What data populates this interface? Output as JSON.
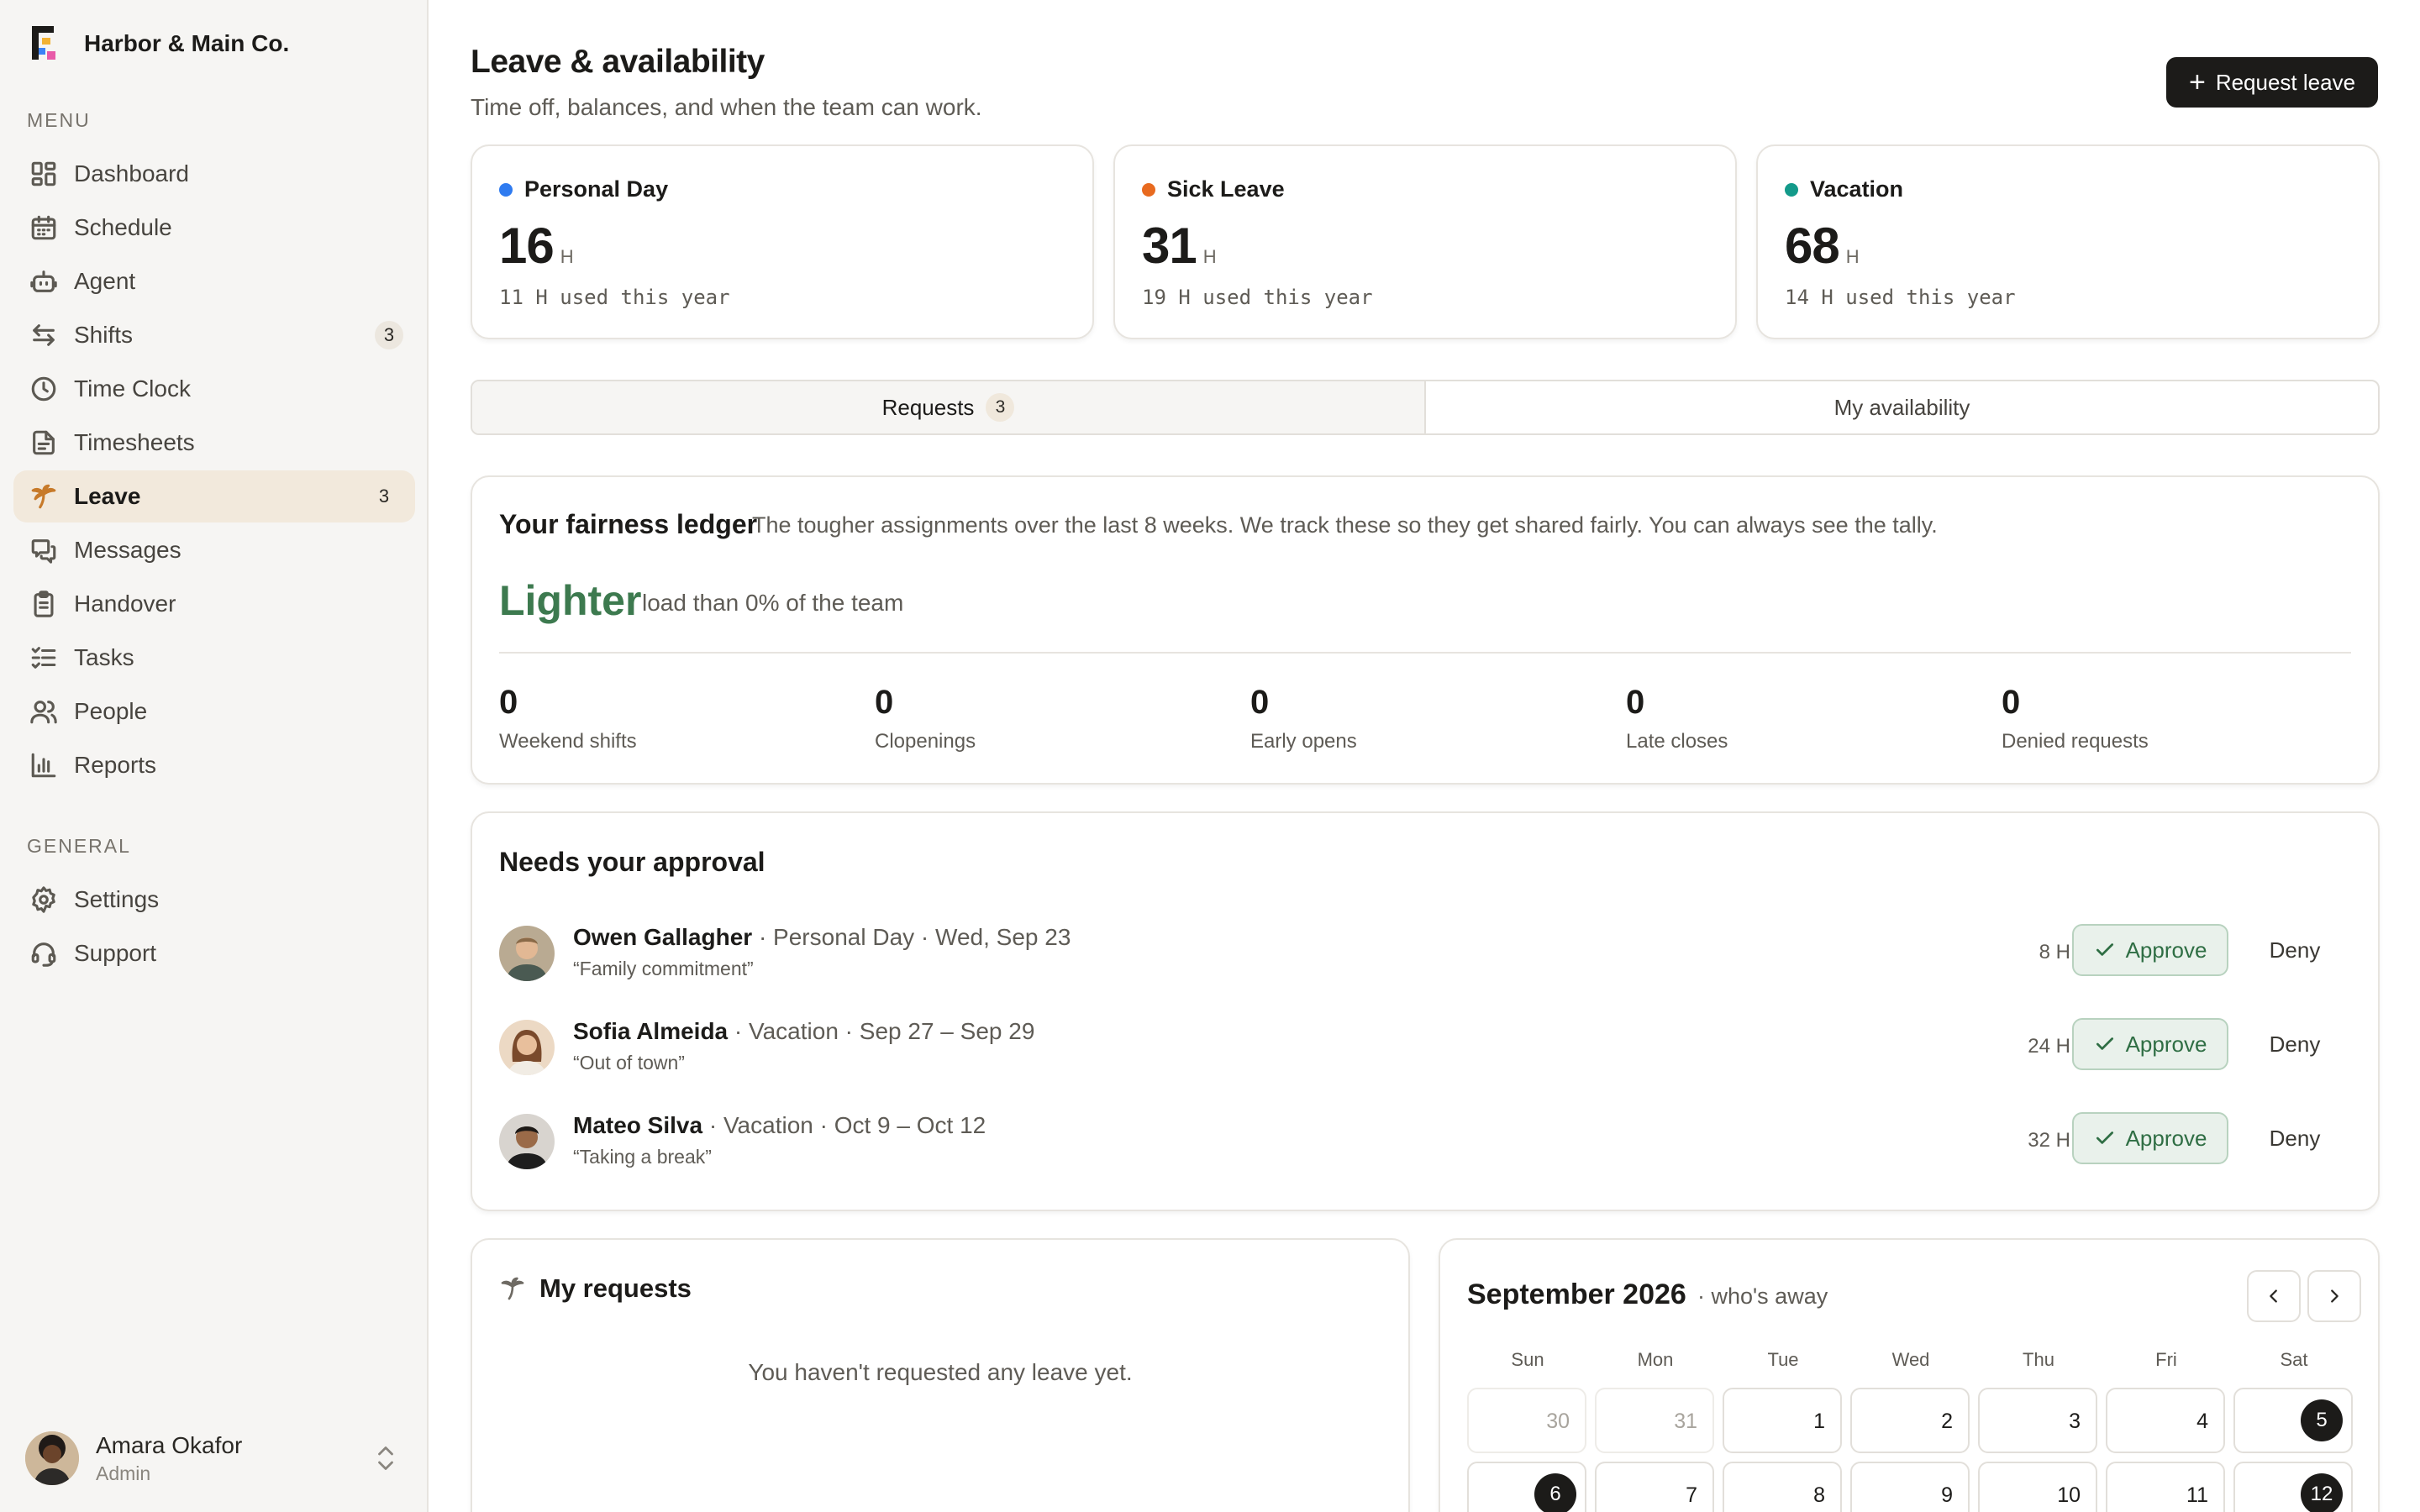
{
  "app": {
    "name": "Harbor & Main Co."
  },
  "sidebar": {
    "menu_label": "MENU",
    "general_label": "GENERAL",
    "menu_items": [
      {
        "label": "Dashboard",
        "icon": "dashboard-icon",
        "badge": ""
      },
      {
        "label": "Schedule",
        "icon": "calendar-icon",
        "badge": ""
      },
      {
        "label": "Agent",
        "icon": "robot-icon",
        "badge": ""
      },
      {
        "label": "Shifts",
        "icon": "swap-icon",
        "badge": "3"
      },
      {
        "label": "Time Clock",
        "icon": "clock-icon",
        "badge": ""
      },
      {
        "label": "Timesheets",
        "icon": "document-icon",
        "badge": ""
      },
      {
        "label": "Leave",
        "icon": "palm-tree-icon",
        "badge": "3",
        "active": true
      },
      {
        "label": "Messages",
        "icon": "chat-icon",
        "badge": ""
      },
      {
        "label": "Handover",
        "icon": "clipboard-icon",
        "badge": ""
      },
      {
        "label": "Tasks",
        "icon": "checklist-icon",
        "badge": ""
      },
      {
        "label": "People",
        "icon": "people-icon",
        "badge": ""
      },
      {
        "label": "Reports",
        "icon": "bar-chart-icon",
        "badge": ""
      }
    ],
    "general_items": [
      {
        "label": "Settings",
        "icon": "gear-icon"
      },
      {
        "label": "Support",
        "icon": "headset-icon"
      }
    ],
    "user": {
      "name": "Amara Okafor",
      "role": "Admin"
    }
  },
  "header": {
    "title": "Leave & availability",
    "subtitle": "Time off, balances, and when the team can work.",
    "request_button": "Request leave"
  },
  "balances": [
    {
      "name": "Personal Day",
      "value": "16",
      "unit": "H",
      "used": "11 H used this year",
      "color": "#2f7bf0"
    },
    {
      "name": "Sick Leave",
      "value": "31",
      "unit": "H",
      "used": "19 H used this year",
      "color": "#e86a1f"
    },
    {
      "name": "Vacation",
      "value": "68",
      "unit": "H",
      "used": "14 H used this year",
      "color": "#139a8a"
    }
  ],
  "tabs": [
    {
      "label": "Requests",
      "badge": "3",
      "active": true
    },
    {
      "label": "My availability",
      "badge": ""
    }
  ],
  "fairness": {
    "title": "Your fairness ledger",
    "description": "The tougher assignments over the last 8 weeks. We track these so they get shared fairly. You can always see the tally.",
    "level": "Lighter",
    "note": "load than 0% of the team",
    "accent": "#3d7a4f",
    "stats": [
      {
        "value": "0",
        "label": "Weekend shifts"
      },
      {
        "value": "0",
        "label": "Clopenings"
      },
      {
        "value": "0",
        "label": "Early opens"
      },
      {
        "value": "0",
        "label": "Late closes"
      },
      {
        "value": "0",
        "label": "Denied requests"
      }
    ]
  },
  "approvals": {
    "title": "Needs your approval",
    "approve_label": "Approve",
    "deny_label": "Deny",
    "requests": [
      {
        "name": "Owen Gallagher",
        "details": " · Personal Day · Wed, Sep 23",
        "quote": "“Family commitment”",
        "hours": "8 H"
      },
      {
        "name": "Sofia Almeida",
        "details": " · Vacation · Sep 27 – Sep 29",
        "quote": "“Out of town”",
        "hours": "24 H"
      },
      {
        "name": "Mateo Silva",
        "details": " · Vacation · Oct 9 – Oct 12",
        "quote": "“Taking a break”",
        "hours": "32 H"
      }
    ]
  },
  "my_requests": {
    "title": "My requests",
    "empty": "You haven't requested any leave yet."
  },
  "calendar": {
    "month": "September 2026",
    "subtitle": "· who's away",
    "weekdays": [
      "Sun",
      "Mon",
      "Tue",
      "Wed",
      "Thu",
      "Fri",
      "Sat"
    ],
    "days": [
      {
        "d": "30",
        "muted": true
      },
      {
        "d": "31",
        "muted": true
      },
      {
        "d": "1"
      },
      {
        "d": "2"
      },
      {
        "d": "3"
      },
      {
        "d": "4"
      },
      {
        "d": "5",
        "away": true
      },
      {
        "d": "6",
        "away": true
      },
      {
        "d": "7"
      },
      {
        "d": "8"
      },
      {
        "d": "9"
      },
      {
        "d": "10"
      },
      {
        "d": "11"
      },
      {
        "d": "12",
        "away": true
      }
    ]
  }
}
